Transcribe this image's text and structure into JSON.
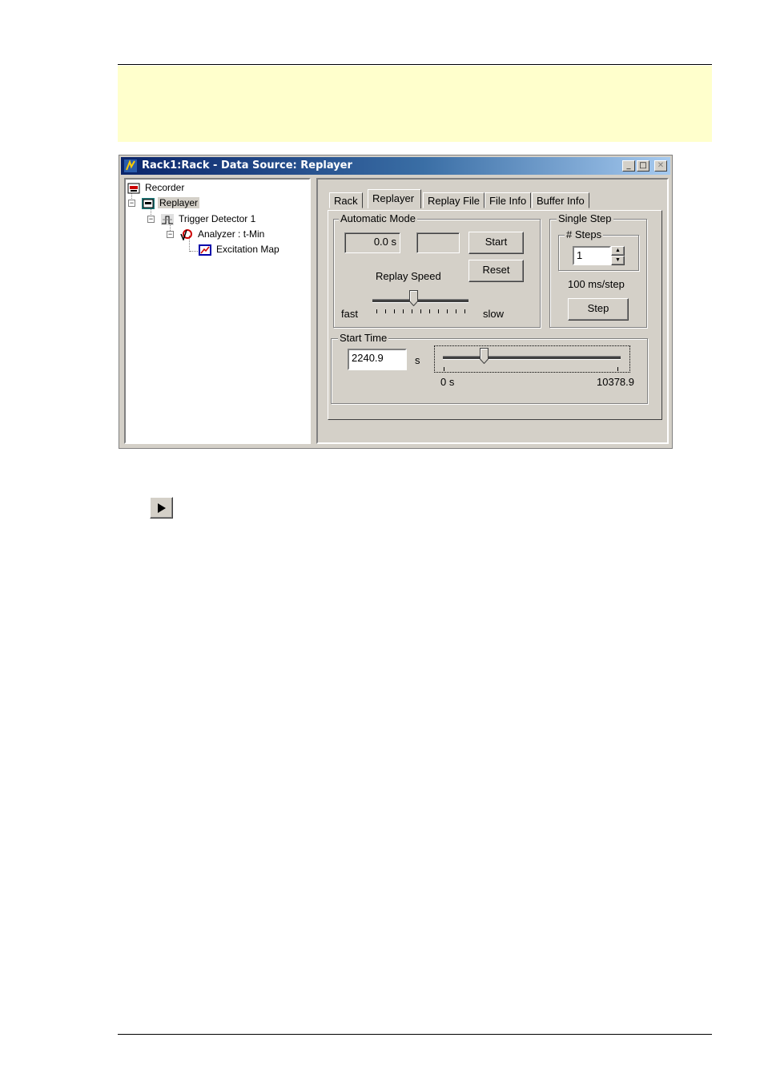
{
  "window": {
    "title": "Rack1:Rack - Data Source: Replayer",
    "controls": {
      "minimize": "_",
      "maximize": "□",
      "close": "✕"
    }
  },
  "tree": {
    "items": [
      {
        "label": "Recorder",
        "icon": "recorder-icon"
      },
      {
        "label": "Replayer",
        "icon": "replayer-icon",
        "selected": true
      },
      {
        "label": "Trigger Detector 1",
        "icon": "trigger-icon"
      },
      {
        "label": "Analyzer : t-Min",
        "icon": "analyzer-icon"
      },
      {
        "label": "Excitation Map",
        "icon": "map-icon"
      }
    ]
  },
  "tabs": [
    {
      "label": "Rack"
    },
    {
      "label": "Replayer",
      "active": true
    },
    {
      "label": "Replay File"
    },
    {
      "label": "File Info"
    },
    {
      "label": "Buffer Info"
    }
  ],
  "automatic_mode": {
    "title": "Automatic Mode",
    "time_readout": "0.0 s",
    "empty_readout": "",
    "start_label": "Start",
    "reset_label": "Reset",
    "speed_label": "Replay Speed",
    "fast_label": "fast",
    "slow_label": "slow",
    "speed_position_fraction": 0.42
  },
  "single_step": {
    "title": "Single Step",
    "steps_title": "# Steps",
    "steps_value": "1",
    "rate_label": "100 ms/step",
    "step_label": "Step"
  },
  "start_time": {
    "title": "Start Time",
    "value": "2240.9",
    "unit": "s",
    "min_label": "0 s",
    "max_label": "10378.9",
    "position_fraction": 0.216
  },
  "play_icon": "play-icon"
}
